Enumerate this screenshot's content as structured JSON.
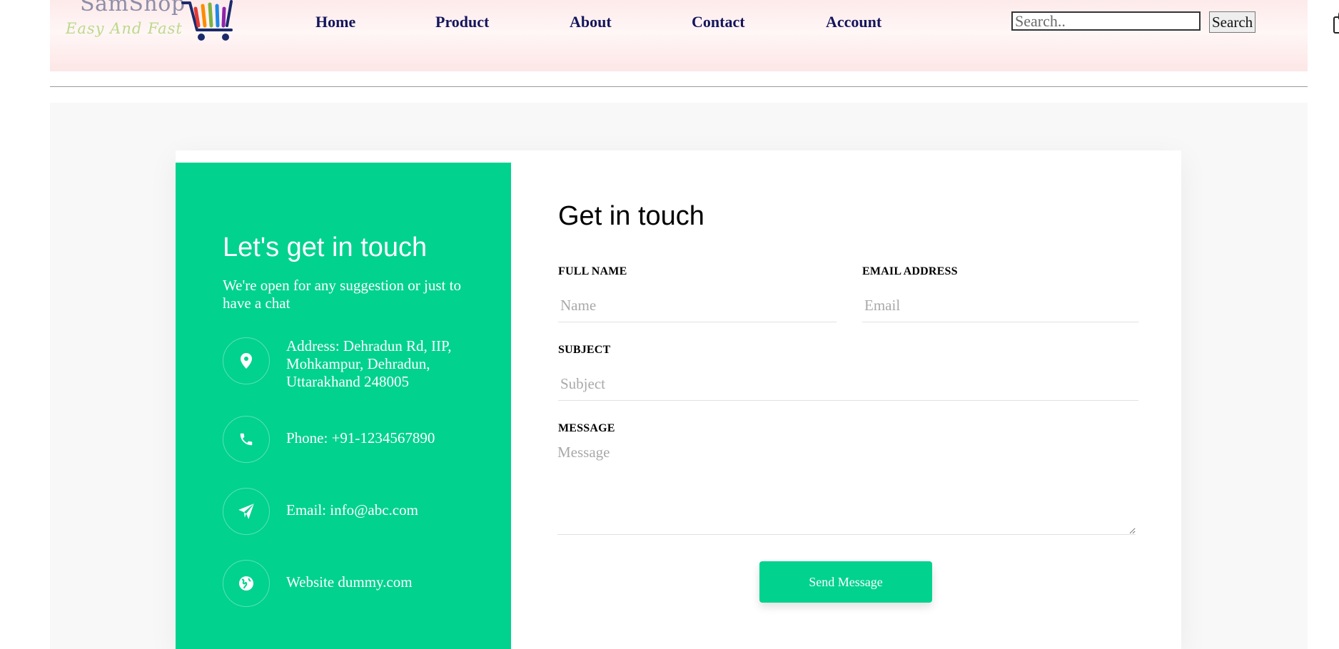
{
  "header": {
    "logo": {
      "name": "SamShop",
      "tagline": "Easy And Fast"
    },
    "nav": [
      {
        "label": "Home"
      },
      {
        "label": "Product"
      },
      {
        "label": "About"
      },
      {
        "label": "Contact"
      },
      {
        "label": "Account"
      }
    ],
    "search": {
      "placeholder": "Search..",
      "value": "",
      "button_label": "Search"
    },
    "icons": {
      "cart": "shopping-bag-icon"
    }
  },
  "contact_info": {
    "title": "Let's get in touch",
    "subtitle": "We're open for any suggestion or just to have a chat",
    "items": [
      {
        "icon": "map-marker-icon",
        "text": "Address: Dehradun Rd, IIP, Mohkampur, Dehradun, Uttarakhand 248005"
      },
      {
        "icon": "phone-icon",
        "text": "Phone: +91-1234567890"
      },
      {
        "icon": "paper-plane-icon",
        "text": "Email: info@abc.com"
      },
      {
        "icon": "globe-icon",
        "text": "Website dummy.com"
      }
    ]
  },
  "form": {
    "title": "Get in touch",
    "full_name": {
      "label": "FULL NAME",
      "placeholder": "Name",
      "value": ""
    },
    "email": {
      "label": "EMAIL ADDRESS",
      "placeholder": "Email",
      "value": ""
    },
    "subject": {
      "label": "SUBJECT",
      "placeholder": "Subject",
      "value": ""
    },
    "message": {
      "label": "MESSAGE",
      "placeholder": "Message",
      "value": ""
    },
    "submit_label": "Send Message"
  },
  "colors": {
    "accent": "#01d28e",
    "nav_text": "#15155c",
    "header_bg": "#fdeaea"
  }
}
